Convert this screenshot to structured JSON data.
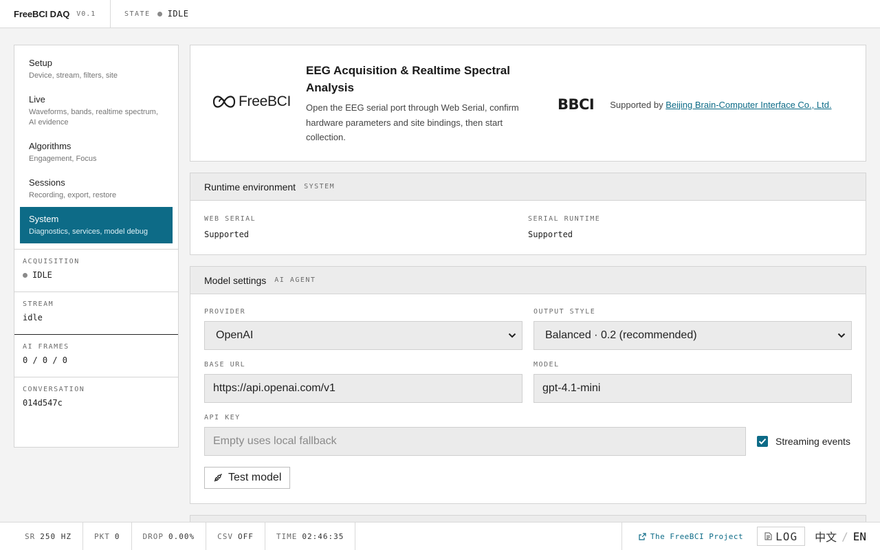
{
  "topbar": {
    "app_name": "FreeBCI DAQ",
    "version": "V0.1",
    "state_label": "STATE",
    "state_value": "IDLE"
  },
  "sidebar": {
    "nav": [
      {
        "title": "Setup",
        "subtitle": "Device, stream, filters, site"
      },
      {
        "title": "Live",
        "subtitle": "Waveforms, bands, realtime spectrum, AI evidence"
      },
      {
        "title": "Algorithms",
        "subtitle": "Engagement, Focus"
      },
      {
        "title": "Sessions",
        "subtitle": "Recording, export, restore"
      },
      {
        "title": "System",
        "subtitle": "Diagnostics, services, model debug"
      }
    ],
    "active_index": 4,
    "stats": {
      "acquisition_label": "ACQUISITION",
      "acquisition_value": "IDLE",
      "stream_label": "STREAM",
      "stream_value": "idle",
      "ai_frames_label": "AI FRAMES",
      "ai_frames_value": "0 / 0 / 0",
      "conversation_label": "CONVERSATION",
      "conversation_value": "014d547c"
    }
  },
  "hero": {
    "logo_text": "FreeBCI",
    "title": "EEG Acquisition & Realtime Spectral Analysis",
    "description": "Open the EEG serial port through Web Serial, confirm hardware parameters and site bindings, then start collection.",
    "partner_logo": "BBCI",
    "supported_by": "Supported by",
    "partner_link": "Beijing Brain-Computer Interface Co., Ltd."
  },
  "runtime": {
    "title": "Runtime environment",
    "tag": "SYSTEM",
    "web_serial_label": "WEB SERIAL",
    "web_serial_value": "Supported",
    "serial_runtime_label": "SERIAL RUNTIME",
    "serial_runtime_value": "Supported"
  },
  "model": {
    "title": "Model settings",
    "tag": "AI AGENT",
    "provider_label": "PROVIDER",
    "provider_value": "OpenAI",
    "output_style_label": "OUTPUT STYLE",
    "output_style_value": "Balanced · 0.2 (recommended)",
    "base_url_label": "BASE URL",
    "base_url_value": "https://api.openai.com/v1",
    "model_label": "MODEL",
    "model_value": "gpt-4.1-mini",
    "api_key_label": "API KEY",
    "api_key_placeholder": "Empty uses local fallback",
    "streaming_label": "Streaming events",
    "streaming_checked": true,
    "test_button": "Test model"
  },
  "footer": {
    "sr_key": "SR",
    "sr_val": "250 HZ",
    "pkt_key": "PKT",
    "pkt_val": "0",
    "drop_key": "DROP",
    "drop_val": "0.00%",
    "csv_key": "CSV",
    "csv_val": "OFF",
    "time_key": "TIME",
    "time_val": "02:46:35",
    "project_link": "The FreeBCI Project",
    "log_button": "LOG",
    "lang_zh": "中文",
    "lang_sep": "/",
    "lang_en": "EN"
  },
  "colors": {
    "accent": "#0d6b87",
    "idle_dot": "#8a8a8a"
  }
}
